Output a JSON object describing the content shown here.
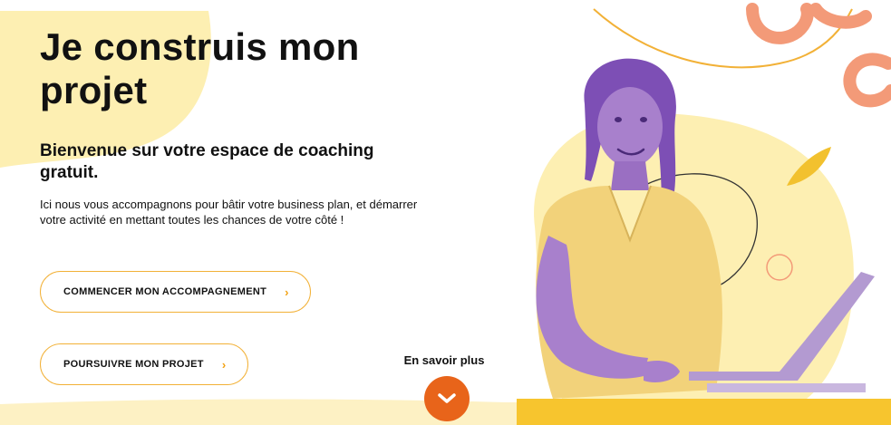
{
  "hero": {
    "title": "Je construis mon projet",
    "subtitle": "Bienvenue sur votre espace de coaching gratuit.",
    "description": "Ici nous vous accompagnons pour bâtir votre business plan, et démarrer votre activité en mettant toutes les chances de votre côté !"
  },
  "buttons": {
    "start_label": "COMMENCER MON ACCOMPAGNEMENT",
    "continue_label": "POURSUIVRE MON PROJET",
    "chevron": "›"
  },
  "learn_more": {
    "label": "En savoir plus",
    "icon": "chevron-down-icon"
  },
  "colors": {
    "accent_orange": "#e8641a",
    "button_border": "#f2b137",
    "pale_yellow": "#fdefb2",
    "coral": "#f39a78",
    "purple": "#7d4fb5"
  }
}
